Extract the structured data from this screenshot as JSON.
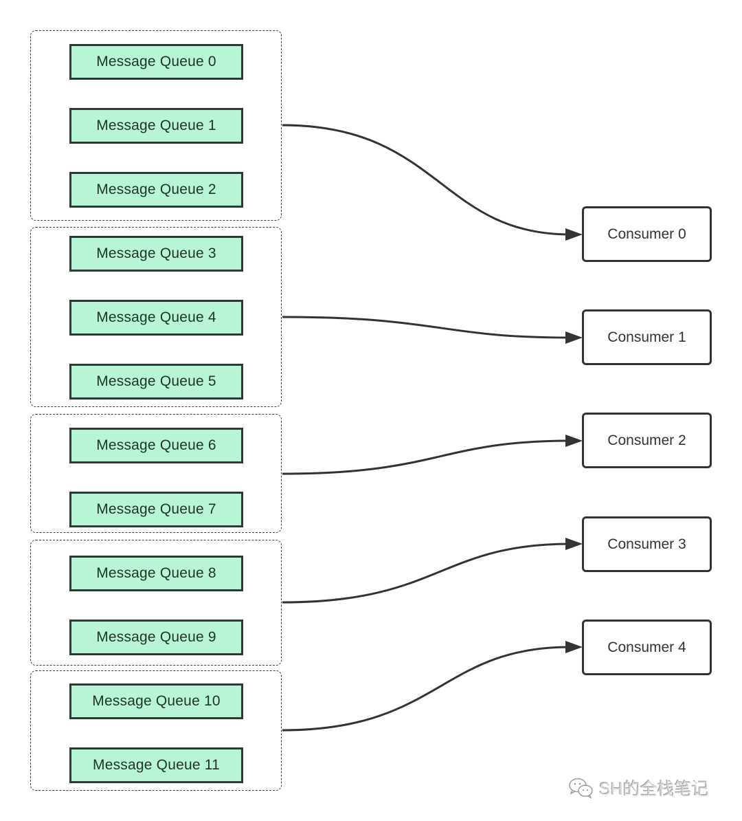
{
  "diagram": {
    "title": "",
    "groups": [
      {
        "id": "group-0",
        "queues": [
          "Message Queue 0",
          "Message Queue 1",
          "Message Queue 2"
        ],
        "consumer": "Consumer 0"
      },
      {
        "id": "group-1",
        "queues": [
          "Message Queue 3",
          "Message Queue 4",
          "Message Queue 5"
        ],
        "consumer": "Consumer 1"
      },
      {
        "id": "group-2",
        "queues": [
          "Message Queue 6",
          "Message Queue 7"
        ],
        "consumer": "Consumer 2"
      },
      {
        "id": "group-3",
        "queues": [
          "Message Queue 8",
          "Message Queue 9"
        ],
        "consumer": "Consumer 3"
      },
      {
        "id": "group-4",
        "queues": [
          "Message Queue 10",
          "Message Queue 11"
        ],
        "consumer": "Consumer 4"
      }
    ],
    "queues": [
      "Message Queue 0",
      "Message Queue 1",
      "Message Queue 2",
      "Message Queue 3",
      "Message Queue 4",
      "Message Queue 5",
      "Message Queue 6",
      "Message Queue 7",
      "Message Queue 8",
      "Message Queue 9",
      "Message Queue 10",
      "Message Queue 11"
    ],
    "consumers": [
      "Consumer 0",
      "Consumer 1",
      "Consumer 2",
      "Consumer 3",
      "Consumer 4"
    ],
    "edges": [
      {
        "from": "group-0",
        "to": "Consumer 0"
      },
      {
        "from": "group-1",
        "to": "Consumer 1"
      },
      {
        "from": "group-2",
        "to": "Consumer 2"
      },
      {
        "from": "group-3",
        "to": "Consumer 3"
      },
      {
        "from": "group-4",
        "to": "Consumer 4"
      }
    ],
    "colors": {
      "queue_fill": "#b7f5d6",
      "queue_border": "#2b3a32",
      "consumer_border": "#333333",
      "arrow": "#333333",
      "group_border": "#3a3a3a"
    }
  },
  "watermark": {
    "icon": "wechat-icon",
    "text": "SH的全栈笔记"
  }
}
